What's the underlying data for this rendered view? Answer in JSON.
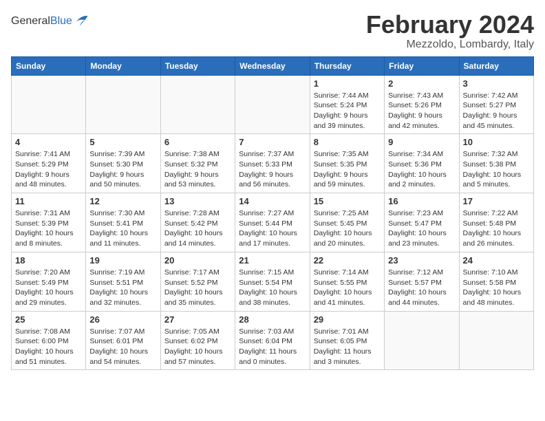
{
  "header": {
    "logo_general": "General",
    "logo_blue": "Blue",
    "month_title": "February 2024",
    "location": "Mezzoldo, Lombardy, Italy"
  },
  "weekdays": [
    "Sunday",
    "Monday",
    "Tuesday",
    "Wednesday",
    "Thursday",
    "Friday",
    "Saturday"
  ],
  "weeks": [
    [
      {
        "day": "",
        "info": ""
      },
      {
        "day": "",
        "info": ""
      },
      {
        "day": "",
        "info": ""
      },
      {
        "day": "",
        "info": ""
      },
      {
        "day": "1",
        "info": "Sunrise: 7:44 AM\nSunset: 5:24 PM\nDaylight: 9 hours\nand 39 minutes."
      },
      {
        "day": "2",
        "info": "Sunrise: 7:43 AM\nSunset: 5:26 PM\nDaylight: 9 hours\nand 42 minutes."
      },
      {
        "day": "3",
        "info": "Sunrise: 7:42 AM\nSunset: 5:27 PM\nDaylight: 9 hours\nand 45 minutes."
      }
    ],
    [
      {
        "day": "4",
        "info": "Sunrise: 7:41 AM\nSunset: 5:29 PM\nDaylight: 9 hours\nand 48 minutes."
      },
      {
        "day": "5",
        "info": "Sunrise: 7:39 AM\nSunset: 5:30 PM\nDaylight: 9 hours\nand 50 minutes."
      },
      {
        "day": "6",
        "info": "Sunrise: 7:38 AM\nSunset: 5:32 PM\nDaylight: 9 hours\nand 53 minutes."
      },
      {
        "day": "7",
        "info": "Sunrise: 7:37 AM\nSunset: 5:33 PM\nDaylight: 9 hours\nand 56 minutes."
      },
      {
        "day": "8",
        "info": "Sunrise: 7:35 AM\nSunset: 5:35 PM\nDaylight: 9 hours\nand 59 minutes."
      },
      {
        "day": "9",
        "info": "Sunrise: 7:34 AM\nSunset: 5:36 PM\nDaylight: 10 hours\nand 2 minutes."
      },
      {
        "day": "10",
        "info": "Sunrise: 7:32 AM\nSunset: 5:38 PM\nDaylight: 10 hours\nand 5 minutes."
      }
    ],
    [
      {
        "day": "11",
        "info": "Sunrise: 7:31 AM\nSunset: 5:39 PM\nDaylight: 10 hours\nand 8 minutes."
      },
      {
        "day": "12",
        "info": "Sunrise: 7:30 AM\nSunset: 5:41 PM\nDaylight: 10 hours\nand 11 minutes."
      },
      {
        "day": "13",
        "info": "Sunrise: 7:28 AM\nSunset: 5:42 PM\nDaylight: 10 hours\nand 14 minutes."
      },
      {
        "day": "14",
        "info": "Sunrise: 7:27 AM\nSunset: 5:44 PM\nDaylight: 10 hours\nand 17 minutes."
      },
      {
        "day": "15",
        "info": "Sunrise: 7:25 AM\nSunset: 5:45 PM\nDaylight: 10 hours\nand 20 minutes."
      },
      {
        "day": "16",
        "info": "Sunrise: 7:23 AM\nSunset: 5:47 PM\nDaylight: 10 hours\nand 23 minutes."
      },
      {
        "day": "17",
        "info": "Sunrise: 7:22 AM\nSunset: 5:48 PM\nDaylight: 10 hours\nand 26 minutes."
      }
    ],
    [
      {
        "day": "18",
        "info": "Sunrise: 7:20 AM\nSunset: 5:49 PM\nDaylight: 10 hours\nand 29 minutes."
      },
      {
        "day": "19",
        "info": "Sunrise: 7:19 AM\nSunset: 5:51 PM\nDaylight: 10 hours\nand 32 minutes."
      },
      {
        "day": "20",
        "info": "Sunrise: 7:17 AM\nSunset: 5:52 PM\nDaylight: 10 hours\nand 35 minutes."
      },
      {
        "day": "21",
        "info": "Sunrise: 7:15 AM\nSunset: 5:54 PM\nDaylight: 10 hours\nand 38 minutes."
      },
      {
        "day": "22",
        "info": "Sunrise: 7:14 AM\nSunset: 5:55 PM\nDaylight: 10 hours\nand 41 minutes."
      },
      {
        "day": "23",
        "info": "Sunrise: 7:12 AM\nSunset: 5:57 PM\nDaylight: 10 hours\nand 44 minutes."
      },
      {
        "day": "24",
        "info": "Sunrise: 7:10 AM\nSunset: 5:58 PM\nDaylight: 10 hours\nand 48 minutes."
      }
    ],
    [
      {
        "day": "25",
        "info": "Sunrise: 7:08 AM\nSunset: 6:00 PM\nDaylight: 10 hours\nand 51 minutes."
      },
      {
        "day": "26",
        "info": "Sunrise: 7:07 AM\nSunset: 6:01 PM\nDaylight: 10 hours\nand 54 minutes."
      },
      {
        "day": "27",
        "info": "Sunrise: 7:05 AM\nSunset: 6:02 PM\nDaylight: 10 hours\nand 57 minutes."
      },
      {
        "day": "28",
        "info": "Sunrise: 7:03 AM\nSunset: 6:04 PM\nDaylight: 11 hours\nand 0 minutes."
      },
      {
        "day": "29",
        "info": "Sunrise: 7:01 AM\nSunset: 6:05 PM\nDaylight: 11 hours\nand 3 minutes."
      },
      {
        "day": "",
        "info": ""
      },
      {
        "day": "",
        "info": ""
      }
    ]
  ]
}
